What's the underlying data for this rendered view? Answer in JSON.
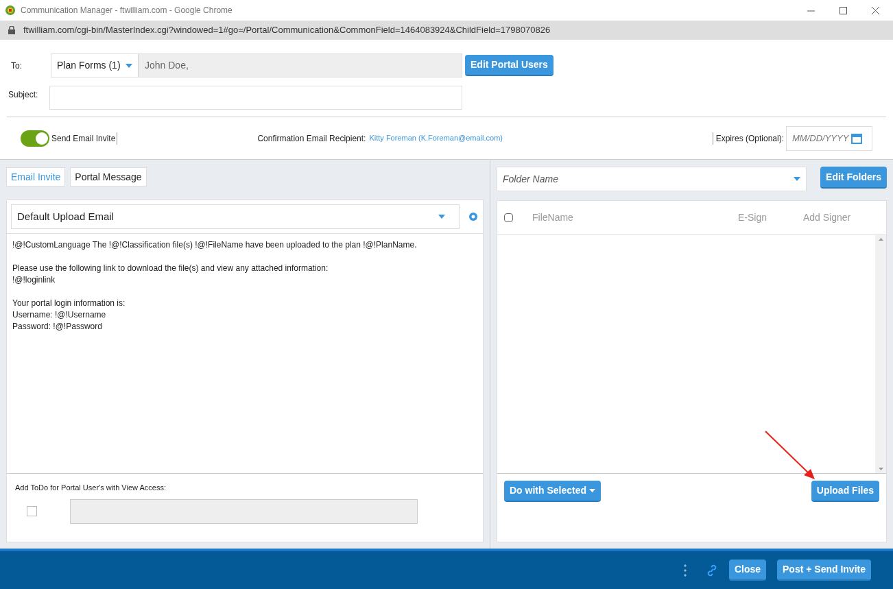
{
  "window": {
    "title": "Communication Manager - ftwilliam.com - Google Chrome"
  },
  "address_bar": {
    "url": "ftwilliam.com/cgi-bin/MasterIndex.cgi?windowed=1#go=/Portal/Communication&CommonField=1464083924&ChildField=1798070826"
  },
  "to": {
    "label": "To:",
    "group": "Plan Forms (1)",
    "recipients": "John Doe,",
    "button": "Edit Portal Users"
  },
  "subject": {
    "label": "Subject:"
  },
  "invite": {
    "label": "Send Email Invite",
    "on": true
  },
  "confirmation": {
    "label": "Confirmation Email Recipient:",
    "recipient": "Kitty Foreman (K.Foreman@email.com)"
  },
  "expires": {
    "label": "Expires (Optional):",
    "placeholder": "MM/DD/YYYY"
  },
  "tabs": [
    {
      "label": "Email Invite",
      "selected": true
    },
    {
      "label": "Portal Message",
      "selected": false
    }
  ],
  "template": {
    "value": "Default Upload Email"
  },
  "message_paragraphs": [
    [
      "!@!CustomLanguage The !@!Classification file(s) !@!FileName have been uploaded to the plan !@!PlanName."
    ],
    [
      "Please use the following link to download the file(s) and view any attached information:",
      "!@!loginlink"
    ],
    [
      "Your portal login information is:",
      "Username: !@!Username",
      "Password: !@!Password"
    ]
  ],
  "todo": {
    "label": "Add ToDo for Portal User's with View Access:",
    "checked": false
  },
  "folder": {
    "placeholder": "Folder Name",
    "button": "Edit Folders"
  },
  "files": {
    "columns": [
      "FileName",
      "E-Sign",
      "Add Signer"
    ],
    "all_checked": false
  },
  "file_actions": {
    "bulk": "Do with Selected",
    "upload": "Upload Files"
  },
  "footer": {
    "buttons": [
      "Close",
      "Post + Send Invite"
    ]
  }
}
